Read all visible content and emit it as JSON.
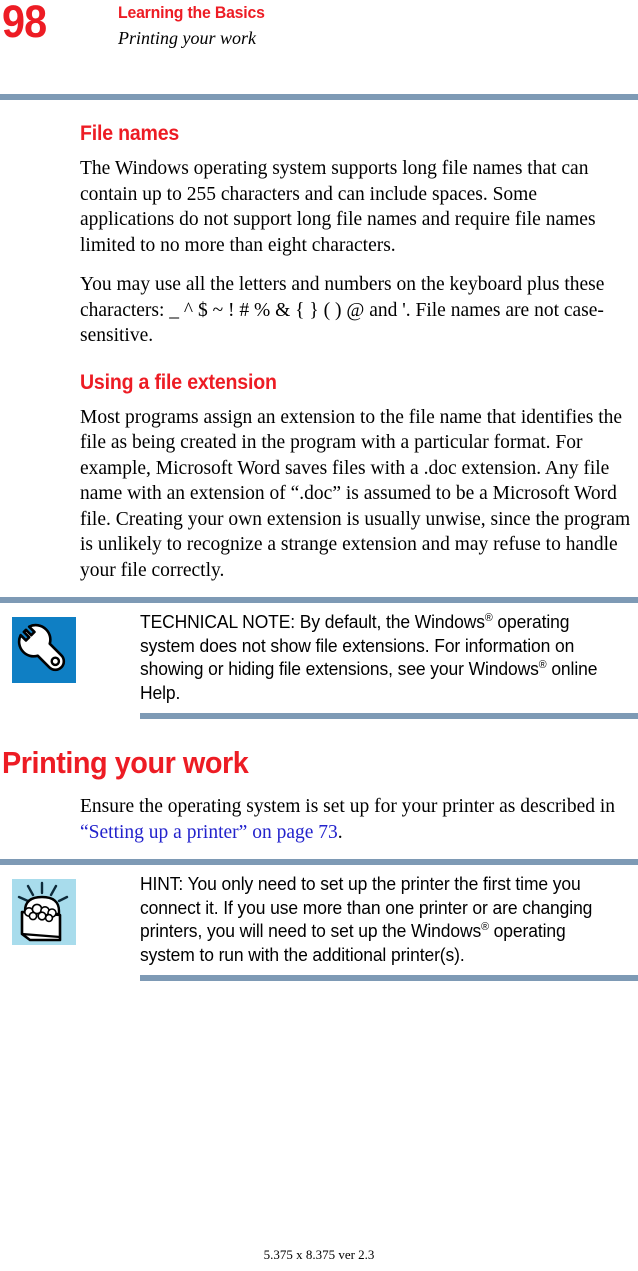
{
  "header": {
    "page_number": "98",
    "chapter": "Learning the Basics",
    "section": "Printing your work",
    "accent_color": "#ed1c24",
    "rule_color": "#7e9ab5"
  },
  "sections": [
    {
      "heading": "File names",
      "level": "h2",
      "paragraphs": [
        "The Windows operating system supports long file names that can contain up to 255 characters and can include spaces. Some applications do not support long file names and require file names limited to no more than eight characters.",
        "You may use all the letters and numbers on the keyboard plus these characters: _ ^ $ ~ ! # % & { } ( ) @ and '. File names are not case-sensitive."
      ]
    },
    {
      "heading": "Using a file extension",
      "level": "h2",
      "paragraphs": [
        "Most programs assign an extension to the file name that identifies the file as being created in the program with a particular format. For example, Microsoft Word saves files with a .doc extension. Any file name with an extension of “.doc” is assumed to be a Microsoft Word file. Creating your own extension is usually unwise, since the program is unlikely to recognize a strange extension and may refuse to handle your file correctly."
      ]
    }
  ],
  "technical_note": {
    "icon_name": "wrench-icon",
    "icon_bg_color": "#0f7fc4",
    "label": "TECHNICAL NOTE:",
    "text_part_1": "TECHNICAL NOTE: By default, the Windows",
    "reg_mark_1": "®",
    "text_part_2": " operating system does not show file extensions. For information on showing or hiding file extensions, see your Windows",
    "reg_mark_2": "®",
    "text_part_3": " online Help."
  },
  "printing_section": {
    "heading": "Printing your work",
    "level": "h1",
    "paragraph_prefix": "Ensure the operating system is set up for your printer as described in ",
    "link_text": "“Setting up a printer” on page 73",
    "link_color": "#2222cc",
    "paragraph_suffix": "."
  },
  "hint_note": {
    "icon_name": "treasure-chest-icon",
    "icon_bg_color": "#a8dcec",
    "label": "HINT:",
    "text_part_1": "HINT: You only need to set up the printer the first time you connect it. If you use more than one printer or are changing printers, you will need to set up the Windows",
    "reg_mark_1": "®",
    "text_part_2": " operating system to run with the additional printer(s)."
  },
  "footer": {
    "text": "5.375 x 8.375 ver 2.3"
  }
}
